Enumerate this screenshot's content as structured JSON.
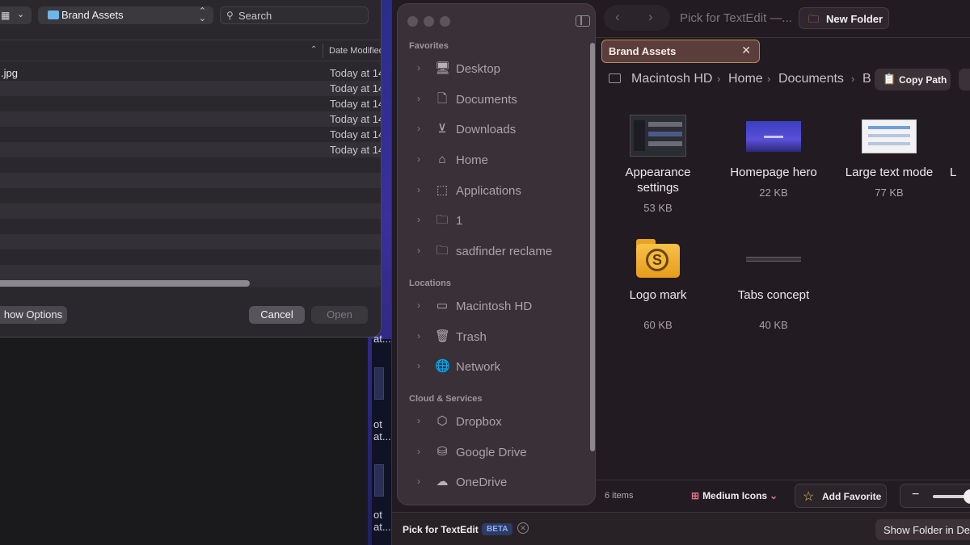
{
  "background": {
    "thumb_labels": [
      "at...",
      "ot",
      "at...",
      "ot",
      "at..."
    ]
  },
  "open_dialog": {
    "location": "Brand Assets",
    "search_placeholder": "Search",
    "column_date": "Date Modified",
    "files": [
      {
        "name": ".jpg",
        "date": "Today at 14"
      },
      {
        "name": "",
        "date": "Today at 14"
      },
      {
        "name": "",
        "date": "Today at 14"
      },
      {
        "name": "",
        "date": "Today at 14"
      },
      {
        "name": "",
        "date": "Today at 14"
      },
      {
        "name": "",
        "date": "Today at 14"
      }
    ],
    "show_options_label": "how Options",
    "cancel_label": "Cancel",
    "open_label": "Open"
  },
  "finder": {
    "title": "Pick for TextEdit —...",
    "new_folder_label": "New Folder",
    "tab_label": "Brand Assets",
    "sidebar": {
      "favorites_heading": "Favorites",
      "locations_heading": "Locations",
      "cloud_heading": "Cloud & Services",
      "favorites": [
        {
          "label": "Desktop",
          "icon": "desktop-icon"
        },
        {
          "label": "Documents",
          "icon": "document-icon"
        },
        {
          "label": "Downloads",
          "icon": "download-icon"
        },
        {
          "label": "Home",
          "icon": "home-icon"
        },
        {
          "label": "Applications",
          "icon": "applications-icon"
        },
        {
          "label": "1",
          "icon": "folder-icon"
        },
        {
          "label": "sadfinder reclame",
          "icon": "folder-icon"
        }
      ],
      "locations": [
        {
          "label": "Macintosh HD",
          "icon": "drive-icon"
        },
        {
          "label": "Trash",
          "icon": "trash-icon"
        },
        {
          "label": "Network",
          "icon": "globe-icon"
        }
      ],
      "cloud": [
        {
          "label": "Dropbox",
          "icon": "dropbox-icon"
        },
        {
          "label": "Google Drive",
          "icon": "google-drive-icon"
        },
        {
          "label": "OneDrive",
          "icon": "cloud-icon"
        }
      ]
    },
    "breadcrumb": [
      "Macintosh HD",
      "Home",
      "Documents",
      "B"
    ],
    "copy_path_label": "Copy Path",
    "items": [
      {
        "name": "Appearance settings",
        "size": "53 KB"
      },
      {
        "name": "Homepage hero",
        "size": "22 KB"
      },
      {
        "name": "Large text mode",
        "size": "77 KB"
      },
      {
        "name": "L",
        "size": ""
      },
      {
        "name": "Logo mark",
        "size": "60 KB"
      },
      {
        "name": "Tabs concept",
        "size": "40 KB"
      }
    ],
    "status_count": "6 items",
    "view_mode_label": "Medium Icons",
    "add_favorite_label": "Add Favorite",
    "zoom_minus": "−",
    "bottom_pick_label": "Pick for TextEdit",
    "beta_label": "BETA",
    "show_folder_label": "Show Folder in Def"
  }
}
